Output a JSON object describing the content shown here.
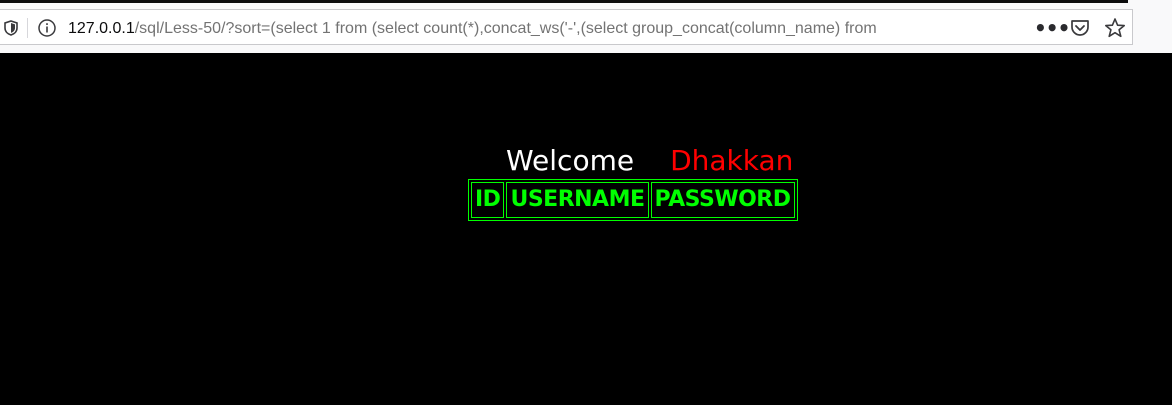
{
  "browser": {
    "url_host": "127.0.0.1",
    "url_rest": "/sql/Less-50/?sort=(select 1 from (select count(*),concat_ws('-',(select group_concat(column_name) from",
    "icons": {
      "tracking_protection": "shield-icon",
      "site_info": "info-icon",
      "page_actions": "more-icon",
      "pocket": "pocket-icon",
      "bookmark": "star-icon"
    },
    "more_label": "•••"
  },
  "page": {
    "welcome_text": "Welcome",
    "user_name": "Dhakkan",
    "colors": {
      "background": "#000000",
      "welcome": "#ffffff",
      "user_name": "#ff0000",
      "table": "#00ff00"
    },
    "table": {
      "headers": [
        "ID",
        "USERNAME",
        "PASSWORD"
      ]
    }
  }
}
